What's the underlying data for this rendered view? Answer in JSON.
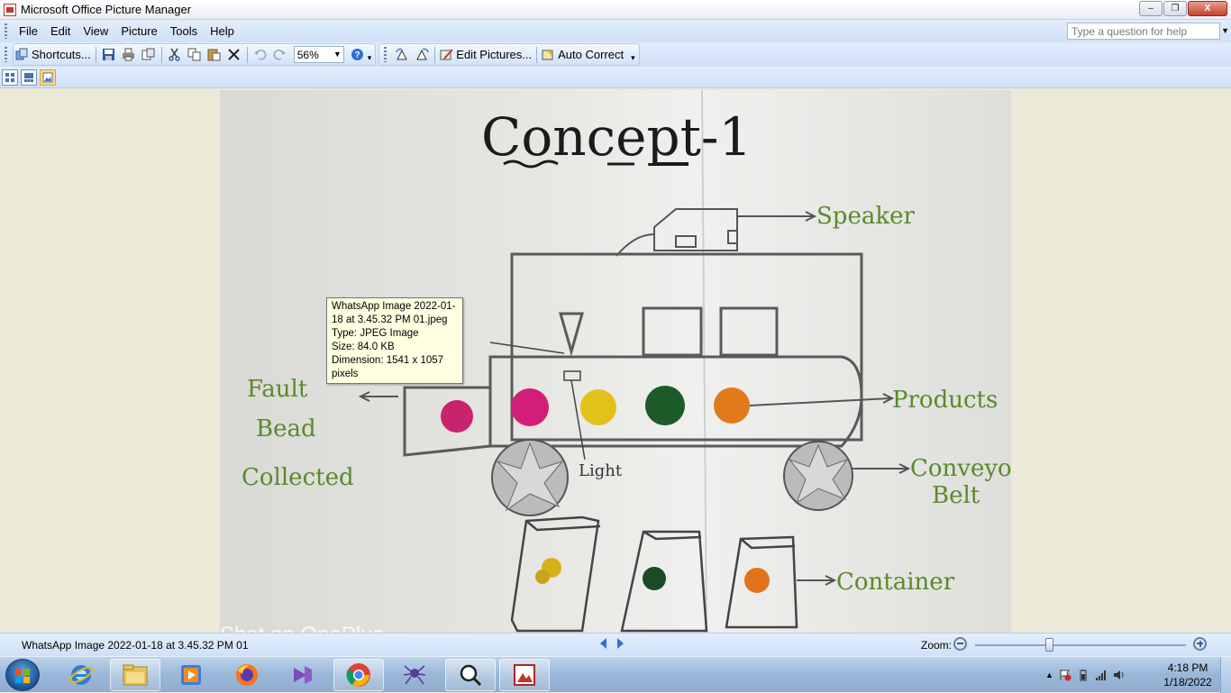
{
  "window": {
    "title": "Microsoft Office Picture Manager",
    "min_label": "–",
    "max_label": "❐",
    "close_label": "X"
  },
  "menu": {
    "items": [
      "File",
      "Edit",
      "View",
      "Picture",
      "Tools",
      "Help"
    ],
    "help_placeholder": "Type a question for help"
  },
  "toolbar": {
    "shortcuts_label": "Shortcuts...",
    "zoom_value": "56%",
    "edit_pictures_label": "Edit Pictures...",
    "auto_correct_label": "Auto Correct"
  },
  "photo": {
    "heading": "Concept-1",
    "labels": {
      "speaker": "Speaker",
      "products": "Products",
      "conveyor_line1": "Conveyor",
      "conveyor_line2": "Belt",
      "container": "Container",
      "fault_line1": "Fault",
      "fault_line2": "Bead",
      "fault_line3": "Collected",
      "light": "Light",
      "watermark": "Shot on OnePlus"
    },
    "bead_colors": [
      "#c8246e",
      "#d21e78",
      "#e2c21a",
      "#1c5a2a",
      "#e07a1a"
    ]
  },
  "tooltip": {
    "line1": "WhatsApp Image 2022-01-",
    "line2": "18 at 3.45.32 PM 01.jpeg",
    "line3": "Type: JPEG Image",
    "line4": "Size: 84.0 KB",
    "line5": "Dimension: 1541 x 1057",
    "line6": "pixels"
  },
  "status": {
    "filename": "WhatsApp Image 2022-01-18 at 3.45.32 PM 01",
    "zoom_label": "Zoom:"
  },
  "zoom_slider": {
    "level_fraction": 0.35
  },
  "taskbar": {
    "time": "4:18 PM",
    "date": "1/18/2022"
  },
  "colors": {
    "accent_blue": "#2f6fd6",
    "label_green": "#5a8a2a",
    "pencil_gray": "#555555"
  }
}
